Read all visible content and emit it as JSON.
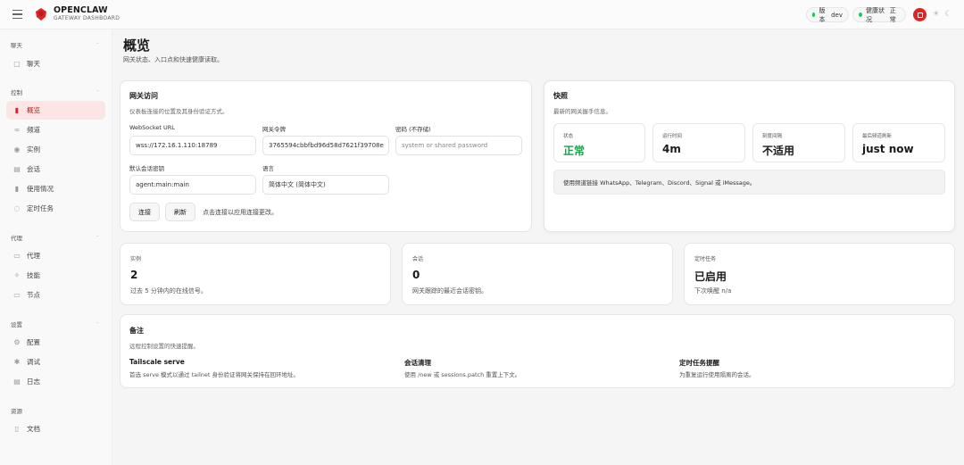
{
  "brand": {
    "name": "OPENCLAW",
    "subtitle": "GATEWAY DASHBOARD"
  },
  "topbar": {
    "version_label": "版本",
    "version_value": "dev",
    "health_label": "健康状况",
    "health_value": "正常",
    "status_color": "#22c55e",
    "accent_color": "#dc2626"
  },
  "sidebar": {
    "sections": [
      {
        "title": "聊天",
        "items": [
          {
            "label": "聊天",
            "icon": "chat-icon"
          }
        ]
      },
      {
        "title": "控制",
        "items": [
          {
            "label": "概览",
            "icon": "bar-chart-icon",
            "active": true
          },
          {
            "label": "频道",
            "icon": "link-icon"
          },
          {
            "label": "实例",
            "icon": "radio-icon"
          },
          {
            "label": "会话",
            "icon": "file-icon"
          },
          {
            "label": "使用情况",
            "icon": "usage-chart-icon"
          },
          {
            "label": "定时任务",
            "icon": "loader-icon"
          }
        ]
      },
      {
        "title": "代理",
        "items": [
          {
            "label": "代理",
            "icon": "folder-icon"
          },
          {
            "label": "技能",
            "icon": "sparkle-icon"
          },
          {
            "label": "节点",
            "icon": "monitor-icon"
          }
        ]
      },
      {
        "title": "设置",
        "items": [
          {
            "label": "配置",
            "icon": "settings-icon"
          },
          {
            "label": "调试",
            "icon": "bug-icon"
          },
          {
            "label": "日志",
            "icon": "log-icon"
          }
        ]
      },
      {
        "title": "资源",
        "items": [
          {
            "label": "文档",
            "icon": "book-icon"
          }
        ]
      }
    ]
  },
  "page": {
    "title": "概览",
    "subtitle": "网关状态、入口点和快速健康读取。"
  },
  "gateway": {
    "title": "网关访问",
    "subtitle": "仪表板连接的位置及其身份验证方式。",
    "ws_label": "WebSocket URL",
    "ws_value": "wss://172.16.1.110:18789",
    "token_label": "网关令牌",
    "token_value": "3765594cbbfbd96d58d7621f39708e",
    "password_label": "密码 (不存储)",
    "password_placeholder": "system or shared password",
    "session_label": "默认会话密钥",
    "session_value": "agent:main:main",
    "lang_label": "语言",
    "lang_value": "简体中文 (简体中文)",
    "connect_label": "连接",
    "refresh_label": "刷新",
    "hint": "点击连接以应用连接更改。"
  },
  "snapshot": {
    "title": "快照",
    "subtitle": "最新的网关握手信息。",
    "stats": [
      {
        "label": "状态",
        "value": "正常",
        "ok": true
      },
      {
        "label": "运行时间",
        "value": "4m"
      },
      {
        "label": "刻度间隔",
        "value": "不适用"
      },
      {
        "label": "最后频道刷新",
        "value": "just now"
      }
    ],
    "info": "使用频道链接 WhatsApp、Telegram、Discord、Signal 或 iMessage。"
  },
  "minis": [
    {
      "label": "实例",
      "value": "2",
      "sub": "过去 5 分钟内的在线信号。"
    },
    {
      "label": "会话",
      "value": "0",
      "sub": "网关跟踪的最近会话密钥。"
    },
    {
      "label": "定时任务",
      "value": "已启用",
      "sub": "下次唤醒 n/a"
    }
  ],
  "notes": {
    "title": "备注",
    "subtitle": "远程控制设置的快速提醒。",
    "items": [
      {
        "title": "Tailscale serve",
        "desc": "首选 serve 模式以通过 tailnet 身份验证将网关保持在回环地址。"
      },
      {
        "title": "会话清理",
        "desc": "使用 /new 或 sessions.patch 重置上下文。"
      },
      {
        "title": "定时任务提醒",
        "desc": "为重复运行使用隔离的会话。"
      }
    ]
  }
}
